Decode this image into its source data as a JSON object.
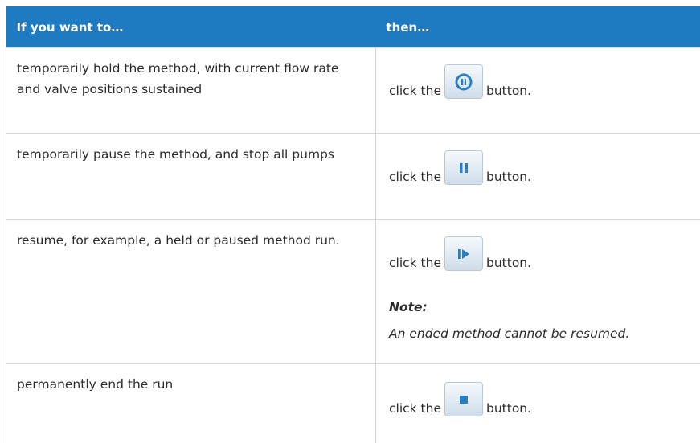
{
  "table": {
    "header": {
      "col1": "If you want to…",
      "col2": "then…"
    },
    "rows": [
      {
        "condition": "temporarily hold the method, with current flow rate and valve positions sustained",
        "before": "click the",
        "after": "button.",
        "icon": "hold-icon"
      },
      {
        "condition": "temporarily pause the method, and stop all pumps",
        "before": "click the",
        "after": "button.",
        "icon": "pause-icon"
      },
      {
        "condition": "resume, for example, a held or paused method run.",
        "before": "click the",
        "after": "button.",
        "icon": "resume-icon",
        "note_label": "Note:",
        "note_text": "An ended method cannot be resumed."
      },
      {
        "condition": "permanently end the run",
        "before": "click the",
        "after": "button.",
        "icon": "end-icon"
      }
    ]
  },
  "colors": {
    "header_bg": "#1f7bc1",
    "icon_blue": "#2a7fc4"
  }
}
